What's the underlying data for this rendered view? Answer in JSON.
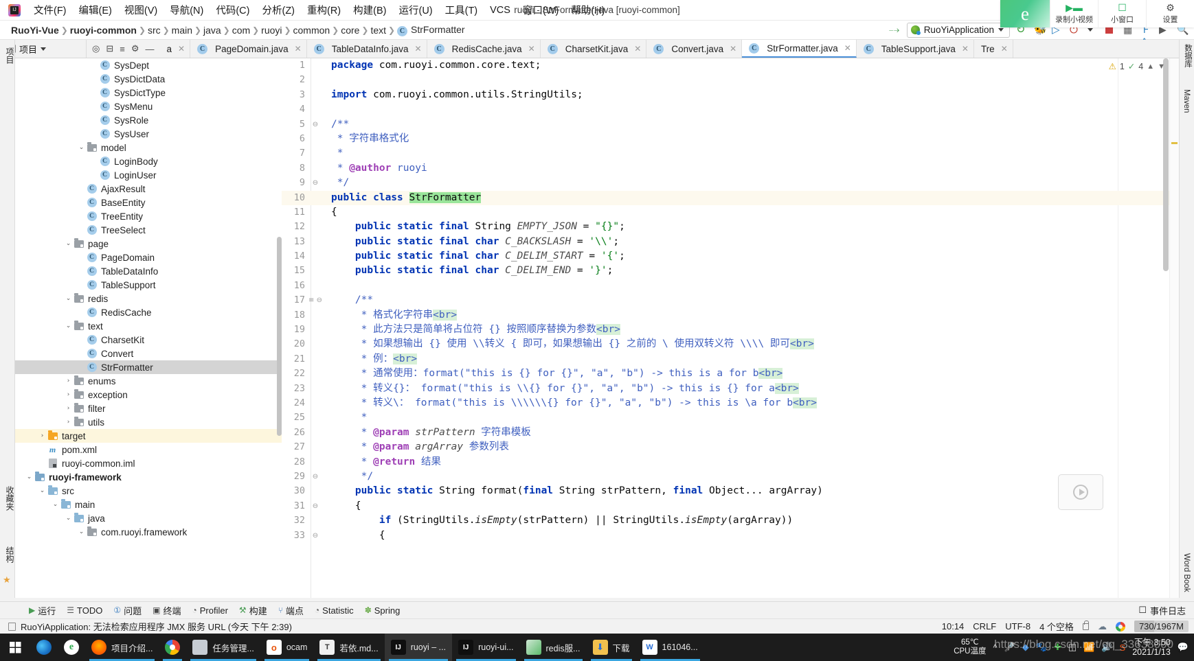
{
  "window": {
    "title": "ruoyi - StrFormatter.java [ruoyi-common]"
  },
  "menu": {
    "items": [
      "文件(F)",
      "编辑(E)",
      "视图(V)",
      "导航(N)",
      "代码(C)",
      "分析(Z)",
      "重构(R)",
      "构建(B)",
      "运行(U)",
      "工具(T)",
      "VCS",
      "窗口(W)",
      "帮助(H)"
    ]
  },
  "breadcrumb": {
    "items": [
      "RuoYi-Vue",
      "ruoyi-common",
      "src",
      "main",
      "java",
      "com",
      "ruoyi",
      "common",
      "core",
      "text"
    ],
    "current_class": "StrFormatter",
    "class_badge": "C"
  },
  "toolbar": {
    "run_config": "RuoYiApplication",
    "icons": [
      "build-hammer-icon",
      "rerun-icon",
      "debug-icon",
      "coverage-icon",
      "profiler-icon",
      "stop-icon",
      "search-icon"
    ]
  },
  "recorder_overlay": {
    "logo": "e",
    "buttons": [
      {
        "icon": "video-camera-icon",
        "label": "录制小视频"
      },
      {
        "icon": "window-icon",
        "label": "小窗口"
      },
      {
        "icon": "gear-icon",
        "label": "设置"
      }
    ]
  },
  "project_panel": {
    "title": "项目",
    "vertical_tabs_left": [
      "项目",
      "收藏夹",
      "结构"
    ],
    "vertical_tabs_right": [
      "数据库",
      "Maven",
      "Word Book"
    ],
    "toolbar_icons": [
      "locate-icon",
      "collapse-all-icon",
      "expand-icon",
      "settings-gear-icon",
      "hide-icon"
    ]
  },
  "tree": [
    {
      "depth": 5,
      "arrow": "none",
      "icon": "class",
      "label": "SysDept"
    },
    {
      "depth": 5,
      "arrow": "none",
      "icon": "class",
      "label": "SysDictData"
    },
    {
      "depth": 5,
      "arrow": "none",
      "icon": "class",
      "label": "SysDictType"
    },
    {
      "depth": 5,
      "arrow": "none",
      "icon": "class",
      "label": "SysMenu"
    },
    {
      "depth": 5,
      "arrow": "none",
      "icon": "class",
      "label": "SysRole"
    },
    {
      "depth": 5,
      "arrow": "none",
      "icon": "class",
      "label": "SysUser"
    },
    {
      "depth": 4,
      "arrow": "down",
      "icon": "folder",
      "label": "model"
    },
    {
      "depth": 5,
      "arrow": "none",
      "icon": "class",
      "label": "LoginBody"
    },
    {
      "depth": 5,
      "arrow": "none",
      "icon": "class",
      "label": "LoginUser"
    },
    {
      "depth": 4,
      "arrow": "none",
      "icon": "class",
      "label": "AjaxResult"
    },
    {
      "depth": 4,
      "arrow": "none",
      "icon": "class",
      "label": "BaseEntity"
    },
    {
      "depth": 4,
      "arrow": "none",
      "icon": "class",
      "label": "TreeEntity"
    },
    {
      "depth": 4,
      "arrow": "none",
      "icon": "class",
      "label": "TreeSelect"
    },
    {
      "depth": 3,
      "arrow": "down",
      "icon": "folder",
      "label": "page"
    },
    {
      "depth": 4,
      "arrow": "none",
      "icon": "class",
      "label": "PageDomain"
    },
    {
      "depth": 4,
      "arrow": "none",
      "icon": "class",
      "label": "TableDataInfo"
    },
    {
      "depth": 4,
      "arrow": "none",
      "icon": "class",
      "label": "TableSupport"
    },
    {
      "depth": 3,
      "arrow": "down",
      "icon": "folder",
      "label": "redis"
    },
    {
      "depth": 4,
      "arrow": "none",
      "icon": "class",
      "label": "RedisCache"
    },
    {
      "depth": 3,
      "arrow": "down",
      "icon": "folder",
      "label": "text"
    },
    {
      "depth": 4,
      "arrow": "none",
      "icon": "class",
      "label": "CharsetKit"
    },
    {
      "depth": 4,
      "arrow": "none",
      "icon": "class",
      "label": "Convert"
    },
    {
      "depth": 4,
      "arrow": "none",
      "icon": "class",
      "label": "StrFormatter",
      "state": "selected"
    },
    {
      "depth": 3,
      "arrow": "right",
      "icon": "folder",
      "label": "enums"
    },
    {
      "depth": 3,
      "arrow": "right",
      "icon": "folder",
      "label": "exception"
    },
    {
      "depth": 3,
      "arrow": "right",
      "icon": "folder",
      "label": "filter"
    },
    {
      "depth": 3,
      "arrow": "right",
      "icon": "folder",
      "label": "utils"
    },
    {
      "depth": 1,
      "arrow": "right",
      "icon": "folder-orange",
      "label": "target",
      "state": "highlight"
    },
    {
      "depth": 1,
      "arrow": "none",
      "icon": "maven",
      "label": "pom.xml"
    },
    {
      "depth": 1,
      "arrow": "none",
      "icon": "iml",
      "label": "ruoyi-common.iml"
    },
    {
      "depth": 0,
      "arrow": "down",
      "icon": "module",
      "label": "ruoyi-framework",
      "bold": true
    },
    {
      "depth": 1,
      "arrow": "down",
      "icon": "folder-src",
      "label": "src"
    },
    {
      "depth": 2,
      "arrow": "down",
      "icon": "folder-src",
      "label": "main"
    },
    {
      "depth": 3,
      "arrow": "down",
      "icon": "folder-src",
      "label": "java"
    },
    {
      "depth": 4,
      "arrow": "down",
      "icon": "folder",
      "label": "com.ruoyi.framework"
    }
  ],
  "editor_tabs": [
    {
      "label": "a",
      "truncated": true,
      "active": false
    },
    {
      "label": "PageDomain.java",
      "active": false
    },
    {
      "label": "TableDataInfo.java",
      "active": false
    },
    {
      "label": "RedisCache.java",
      "active": false
    },
    {
      "label": "CharsetKit.java",
      "active": false
    },
    {
      "label": "Convert.java",
      "active": false
    },
    {
      "label": "StrFormatter.java",
      "active": true
    },
    {
      "label": "TableSupport.java",
      "active": false
    },
    {
      "label": "Tre",
      "truncated": true,
      "active": false
    }
  ],
  "editor": {
    "inspection": {
      "warnings": "1",
      "checks": "4"
    },
    "lines": [
      {
        "n": "1",
        "fold": "",
        "html": "<span class='kw'>package</span> com.ruoyi.common.core.text;"
      },
      {
        "n": "2",
        "fold": "",
        "html": ""
      },
      {
        "n": "3",
        "fold": "",
        "html": "<span class='kw'>import</span> com.ruoyi.common.utils.StringUtils;"
      },
      {
        "n": "4",
        "fold": "",
        "html": ""
      },
      {
        "n": "5",
        "fold": "⊖",
        "html": "<span class='jdoc'>/**</span>"
      },
      {
        "n": "6",
        "fold": "",
        "html": " <span class='jdoc'>* 字符串格式化</span>"
      },
      {
        "n": "7",
        "fold": "",
        "html": " <span class='jdoc'>*</span>"
      },
      {
        "n": "8",
        "fold": "",
        "html": " <span class='jdoc'>* </span><span class='jdoc-tag'>@author</span><span class='jdoc'> ruoyi</span>"
      },
      {
        "n": "9",
        "fold": "⊖",
        "html": " <span class='jdoc'>*/</span>"
      },
      {
        "n": "10",
        "fold": "",
        "html": "<span class='kw'>public class</span> <span class='hl-green'>StrFormatter</span>",
        "current": true
      },
      {
        "n": "11",
        "fold": "",
        "html": "{"
      },
      {
        "n": "12",
        "fold": "",
        "html": "    <span class='kw'>public static final</span> String <span class='cnst'>EMPTY_JSON</span> = <span class='str'>\"{}\"</span>;"
      },
      {
        "n": "13",
        "fold": "",
        "html": "    <span class='kw'>public static final char</span> <span class='cnst'>C_BACKSLASH</span> = <span class='str'>'\\\\'</span>;"
      },
      {
        "n": "14",
        "fold": "",
        "html": "    <span class='kw'>public static final char</span> <span class='cnst'>C_DELIM_START</span> = <span class='str'>'{'</span>;"
      },
      {
        "n": "15",
        "fold": "",
        "html": "    <span class='kw'>public static final char</span> <span class='cnst'>C_DELIM_END</span> = <span class='str'>'}'</span>;"
      },
      {
        "n": "16",
        "fold": "",
        "html": ""
      },
      {
        "n": "17",
        "fold": "⊖",
        "html": "    <span class='jdoc'>/**</span>",
        "gutter_mark": true
      },
      {
        "n": "18",
        "fold": "",
        "html": "     <span class='jdoc'>* 格式化字符串</span><span class='hl-tag'>&lt;br&gt;</span>"
      },
      {
        "n": "19",
        "fold": "",
        "html": "     <span class='jdoc'>* 此方法只是简单将占位符 {} 按照顺序替换为参数</span><span class='hl-tag'>&lt;br&gt;</span>"
      },
      {
        "n": "20",
        "fold": "",
        "html": "     <span class='jdoc'>* 如果想输出 {} 使用 \\\\转义 { 即可，如果想输出 {} 之前的 \\ 使用双转义符 \\\\\\\\ 即可</span><span class='hl-tag'>&lt;br&gt;</span>"
      },
      {
        "n": "21",
        "fold": "",
        "html": "     <span class='jdoc'>* 例：</span><span class='hl-tag'>&lt;br&gt;</span>"
      },
      {
        "n": "22",
        "fold": "",
        "html": "     <span class='jdoc'>* 通常使用：format(\"this is {} for {}\", \"a\", \"b\") -&gt; this is a for b</span><span class='hl-tag'>&lt;br&gt;</span>"
      },
      {
        "n": "23",
        "fold": "",
        "html": "     <span class='jdoc'>* 转义{}： format(\"this is \\\\{} for {}\", \"a\", \"b\") -&gt; this is {} for a</span><span class='hl-tag'>&lt;br&gt;</span>"
      },
      {
        "n": "24",
        "fold": "",
        "html": "     <span class='jdoc'>* 转义\\： format(\"this is \\\\\\\\\\\\{} for {}\", \"a\", \"b\") -&gt; this is \\a for b</span><span class='hl-tag'>&lt;br&gt;</span>"
      },
      {
        "n": "25",
        "fold": "",
        "html": "     <span class='jdoc'>*</span>"
      },
      {
        "n": "26",
        "fold": "",
        "html": "     <span class='jdoc'>* </span><span class='jdoc-tag'>@param</span><span class='jdoc'> </span><span class='cnst'>strPattern</span><span class='jdoc'> 字符串模板</span>"
      },
      {
        "n": "27",
        "fold": "",
        "html": "     <span class='jdoc'>* </span><span class='jdoc-tag'>@param</span><span class='jdoc'> </span><span class='cnst'>argArray</span><span class='jdoc'> 参数列表</span>"
      },
      {
        "n": "28",
        "fold": "",
        "html": "     <span class='jdoc'>* </span><span class='jdoc-tag'>@return</span><span class='jdoc'> 结果</span>"
      },
      {
        "n": "29",
        "fold": "⊖",
        "html": "     <span class='jdoc'>*/</span>"
      },
      {
        "n": "30",
        "fold": "",
        "html": "    <span class='kw'>public static</span> String format(<span class='kw'>final</span> String strPattern, <span class='kw'>final</span> Object... argArray)"
      },
      {
        "n": "31",
        "fold": "⊖",
        "html": "    {"
      },
      {
        "n": "32",
        "fold": "",
        "html": "        <span class='kw'>if</span> (StringUtils.<span class='mth-i'>isEmpty</span>(strPattern) || StringUtils.<span class='mth-i'>isEmpty</span>(argArray))"
      },
      {
        "n": "33",
        "fold": "⊖",
        "html": "        {"
      }
    ]
  },
  "bottom_tools": [
    {
      "icon": "run-icon",
      "label": "运行"
    },
    {
      "icon": "todo-icon",
      "label": "TODO"
    },
    {
      "icon": "problems-icon",
      "label": "问题"
    },
    {
      "icon": "terminal-icon",
      "label": "终端"
    },
    {
      "icon": "profiler-icon",
      "label": "Profiler"
    },
    {
      "icon": "build-icon",
      "label": "构建"
    },
    {
      "icon": "endpoints-icon",
      "label": "端点"
    },
    {
      "icon": "statistic-icon",
      "label": "Statistic"
    },
    {
      "icon": "spring-icon",
      "label": "Spring"
    }
  ],
  "bottom_right": {
    "icon": "event-log-icon",
    "label": "事件日志"
  },
  "status_bar": {
    "message": "RuoYiApplication: 无法检索应用程序 JMX 服务 URL (今天 下午 2:39)",
    "caret": "10:14",
    "line_separator": "CRLF",
    "encoding": "UTF-8",
    "indent": "4 个空格",
    "icons": [
      "lock-icon",
      "cloud-icon",
      "google-icon"
    ],
    "memory": "730/1967M"
  },
  "taskbar": {
    "items": [
      {
        "icon": "edge-icon",
        "label": "",
        "running": false
      },
      {
        "icon": "browser360-icon",
        "label": "",
        "running": false
      },
      {
        "icon": "firefox-icon",
        "label": "项目介绍...",
        "running": true
      },
      {
        "icon": "chrome-icon",
        "label": "",
        "running": true
      },
      {
        "icon": "task-manager-icon",
        "label": "任务管理...",
        "running": true
      },
      {
        "icon": "ocam-icon",
        "label": "ocam",
        "running": true
      },
      {
        "icon": "typora-icon",
        "label": "若依.md...",
        "running": true
      },
      {
        "icon": "intellij-icon",
        "label": "ruoyi – ...",
        "running": true,
        "active": true
      },
      {
        "icon": "intellij-icon",
        "label": "ruoyi-ui...",
        "running": true
      },
      {
        "icon": "redis-icon",
        "label": "redis服...",
        "running": true
      },
      {
        "icon": "downloads-icon",
        "label": "下载",
        "running": true
      },
      {
        "icon": "wps-icon",
        "label": "161046...",
        "running": true
      }
    ],
    "cpu_temp_value": "65℃",
    "cpu_temp_label": "CPU温度",
    "tray_icons": [
      "chevron-up-icon",
      "microphone-icon",
      "layers-icon",
      "qq-icon",
      "plus-icon",
      "battery-icon",
      "wifi-icon",
      "volume-icon",
      "sogou-icon"
    ],
    "clock_time": "下午 3:50",
    "clock_date": "2021/1/13"
  },
  "watermark": "https://blog.csdn.net/qq_33638000"
}
